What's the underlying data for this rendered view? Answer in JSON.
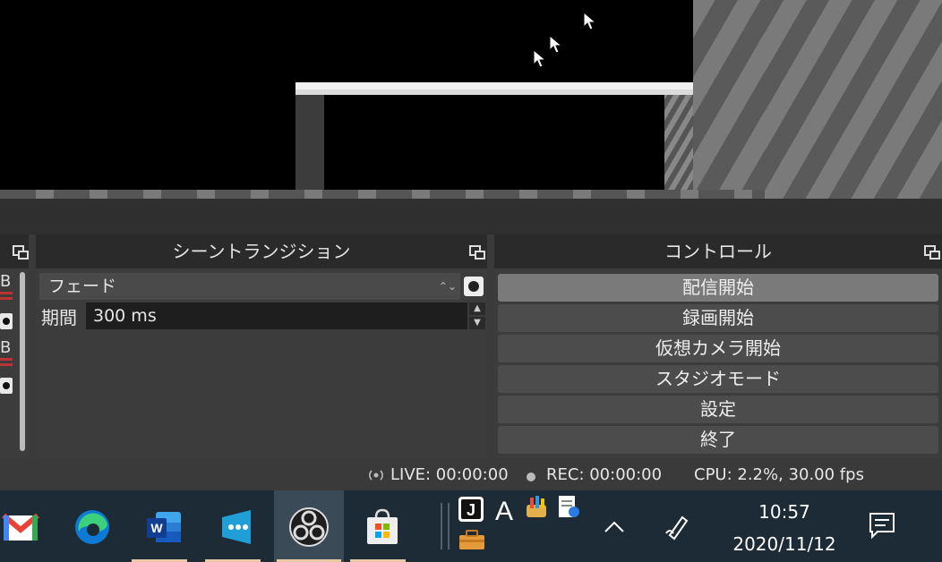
{
  "transition_dock": {
    "title": "シーントランジション",
    "selected_transition": "フェード",
    "duration_label": "期間",
    "duration_value": "300 ms"
  },
  "controls_dock": {
    "title": "コントロール",
    "buttons": [
      {
        "label": "配信開始"
      },
      {
        "label": "録画開始"
      },
      {
        "label": "仮想カメラ開始"
      },
      {
        "label": "スタジオモード"
      },
      {
        "label": "設定"
      },
      {
        "label": "終了"
      }
    ]
  },
  "mixer_fragment": {
    "letters": [
      "B",
      "B"
    ]
  },
  "status_bar": {
    "live": "LIVE: 00:00:00",
    "rec": "REC: 00:00:00",
    "cpu": "CPU: 2.2%, 30.00 fps"
  },
  "taskbar": {
    "apps": [
      "gmail-icon",
      "edge-icon",
      "word-icon",
      "app-icon",
      "obs-icon",
      "store-icon"
    ],
    "active_app": "obs-icon",
    "tray_icons": [
      "j-icon",
      "a-icon",
      "paint-icon",
      "doc-icon",
      "toolbox-icon",
      "chevron-up-icon",
      "pen-icon",
      "notification-icon"
    ],
    "time": "10:57",
    "date": "2020/11/12"
  },
  "colors": {
    "dock_bg": "#3c3c3c",
    "dock_header": "#2a2a2a",
    "taskbar_bg": "#1c2b36",
    "primary_button": "#7a7a7a"
  }
}
